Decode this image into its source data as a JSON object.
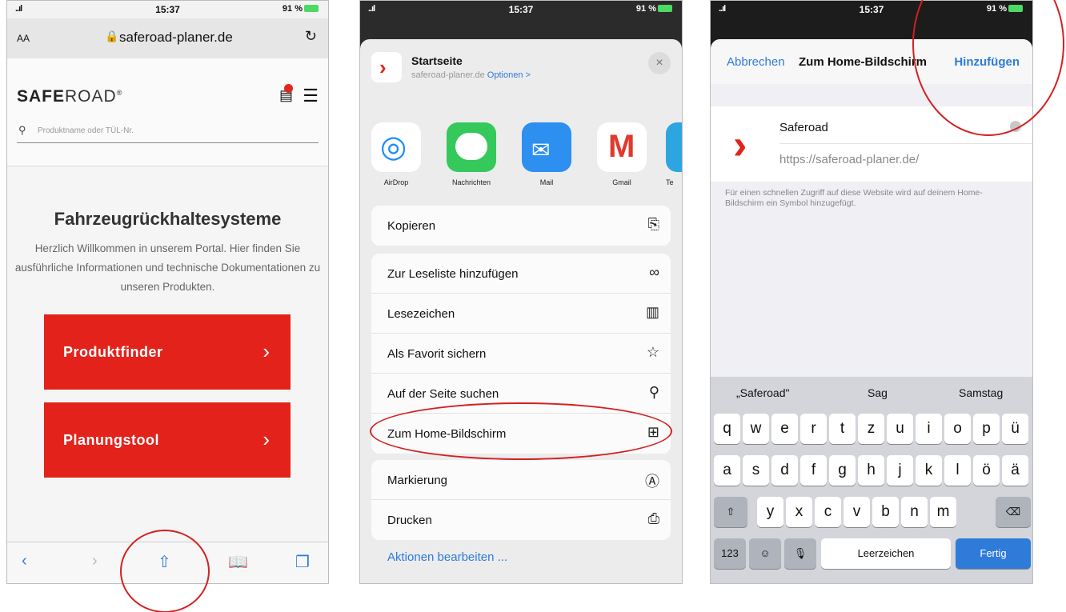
{
  "status": {
    "signal": "..ıl",
    "time": "15:37",
    "battery": "91 %"
  },
  "panel1": {
    "aa": "AA",
    "url": "saferoad-planer.de",
    "logo_bold": "SAFE",
    "logo_rest": "ROAD",
    "logo_mark": "®",
    "search_placeholder": "Produktname oder TÜL-Nr.",
    "heading": "Fahrzeugrückhaltesysteme",
    "intro": "Herzlich Willkommen in unserem Portal. Hier finden Sie ausführliche Informationen und technische Dokumentationen zu unseren Produkten.",
    "buttons": [
      "Produktfinder",
      "Planungstool"
    ]
  },
  "panel2": {
    "title": "Startseite",
    "subtitle": "saferoad-planer.de",
    "options": "Optionen >",
    "apps": [
      "AirDrop",
      "Nachrichten",
      "Mail",
      "Gmail",
      "Te"
    ],
    "copy": "Kopieren",
    "actions": [
      "Zur Leseliste hinzufügen",
      "Lesezeichen",
      "Als Favorit sichern",
      "Auf der Seite suchen",
      "Zum Home-Bildschirm"
    ],
    "actions2": [
      "Markierung",
      "Drucken"
    ],
    "edit": "Aktionen bearbeiten ..."
  },
  "panel3": {
    "cancel": "Abbrechen",
    "title": "Zum Home-Bildschirm",
    "add": "Hinzufügen",
    "name": "Saferoad",
    "url": "https://saferoad-planer.de/",
    "hint": "Für einen schnellen Zugriff auf diese Website wird auf deinem Home-Bildschirm ein Symbol hinzugefügt.",
    "suggestions": [
      "„Saferoad\"",
      "Sag",
      "Samstag"
    ],
    "row1": [
      "q",
      "w",
      "e",
      "r",
      "t",
      "z",
      "u",
      "i",
      "o",
      "p",
      "ü"
    ],
    "row2": [
      "a",
      "s",
      "d",
      "f",
      "g",
      "h",
      "j",
      "k",
      "l",
      "ö",
      "ä"
    ],
    "row3": [
      "y",
      "x",
      "c",
      "v",
      "b",
      "n",
      "m"
    ],
    "num_key": "123",
    "space": "Leerzeichen",
    "done": "Fertig"
  }
}
